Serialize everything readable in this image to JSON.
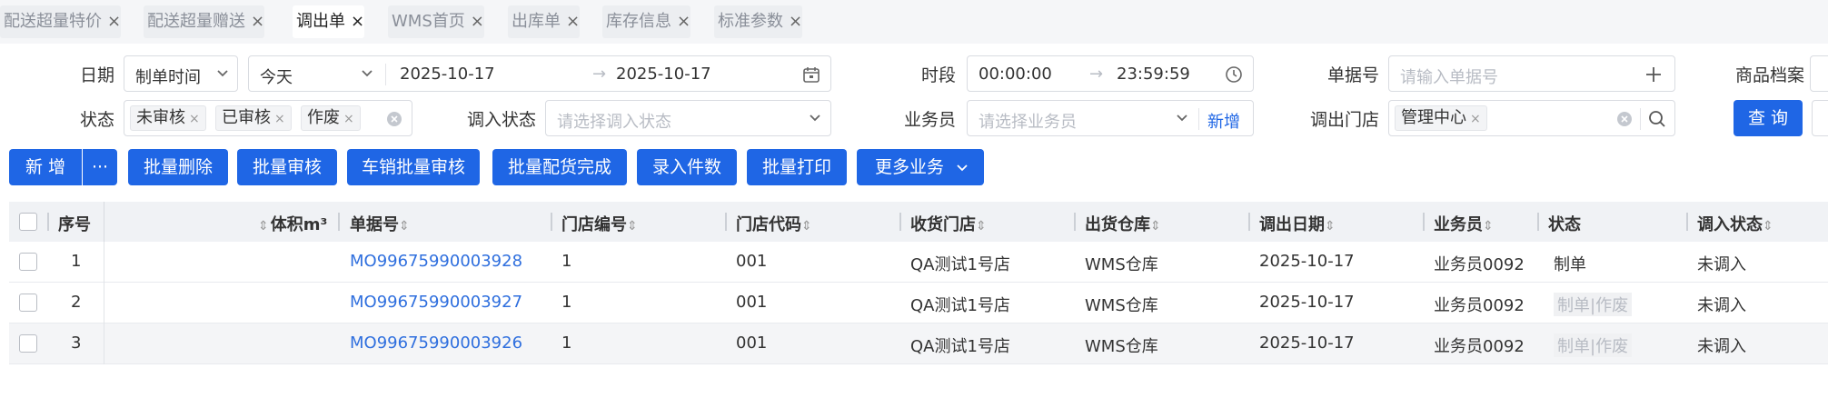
{
  "tabs": [
    {
      "label": "配送超量特价",
      "active": false
    },
    {
      "label": "配送超量赠送",
      "active": false
    },
    {
      "label": "调出单",
      "active": true
    },
    {
      "label": "WMS首页",
      "active": false
    },
    {
      "label": "出库单",
      "active": false
    },
    {
      "label": "库存信息",
      "active": false
    },
    {
      "label": "标准参数",
      "active": false
    }
  ],
  "tab_close_glyph": "×",
  "filters": {
    "date_label": "日期",
    "date_type": "制单时间",
    "date_preset": "今天",
    "date_start": "2025-10-17",
    "date_end": "2025-10-17",
    "range_arrow": "→",
    "time_label": "时段",
    "time_start": "00:00:00",
    "time_end": "23:59:59",
    "doc_no_label": "单据号",
    "doc_no_placeholder": "请输入单据号",
    "product_label": "商品档案",
    "status_label": "状态",
    "status_tags": [
      "未审核",
      "已审核",
      "作废"
    ],
    "in_status_label": "调入状态",
    "in_status_placeholder": "请选择调入状态",
    "salesman_label": "业务员",
    "salesman_placeholder": "请选择业务员",
    "salesman_add": "新增",
    "out_store_label": "调出门店",
    "out_store_tag": "管理中心",
    "query_button": "查 询"
  },
  "actions": {
    "add": "新 增",
    "more_dots": "···",
    "batch_delete": "批量删除",
    "batch_audit": "批量审核",
    "cancel_batch_audit": "车销批量审核",
    "batch_pick_done": "批量配货完成",
    "enter_pieces": "录入件数",
    "batch_print": "批量打印",
    "more_business": "更多业务"
  },
  "table": {
    "headers": {
      "seq": "序号",
      "volume": "体积m³",
      "doc_no": "单据号",
      "store_no": "门店编号",
      "store_code": "门店代码",
      "recv_store": "收货门店",
      "ship_wh": "出货仓库",
      "out_date": "调出日期",
      "salesman": "业务员",
      "status": "状态",
      "in_status": "调入状态"
    },
    "rows": [
      {
        "seq": "1",
        "doc_no": "MO99675990003928",
        "store_no": "1",
        "store_code": "001",
        "recv_store": "QA测试1号店",
        "ship_wh": "WMS仓库",
        "out_date": "2025-10-17",
        "salesman": "业务员0092",
        "status": "制单",
        "in_status": "未调入"
      },
      {
        "seq": "2",
        "doc_no": "MO99675990003927",
        "store_no": "1",
        "store_code": "001",
        "recv_store": "QA测试1号店",
        "ship_wh": "WMS仓库",
        "out_date": "2025-10-17",
        "salesman": "业务员0092",
        "status": "制单|作废",
        "in_status": "未调入"
      },
      {
        "seq": "3",
        "doc_no": "MO99675990003926",
        "store_no": "1",
        "store_code": "001",
        "recv_store": "QA测试1号店",
        "ship_wh": "WMS仓库",
        "out_date": "2025-10-17",
        "salesman": "业务员0092",
        "status": "制单|作废",
        "in_status": "未调入"
      }
    ]
  },
  "colors": {
    "primary": "#1f66e5",
    "link": "#2f6fde"
  }
}
